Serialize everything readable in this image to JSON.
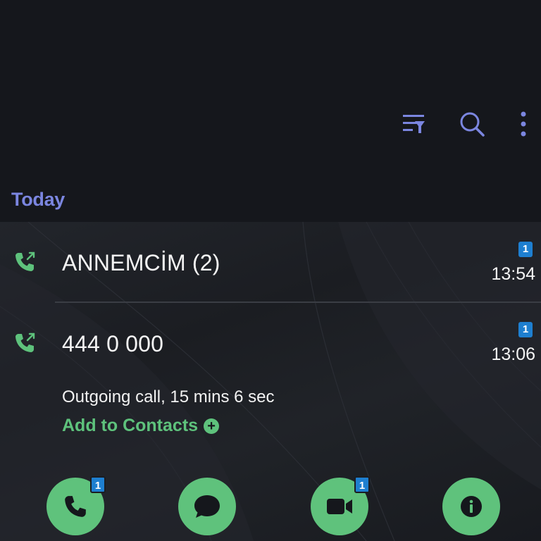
{
  "toolbar": {
    "filter_icon": "filter-list-icon",
    "search_icon": "search-icon",
    "more_icon": "more-vertical-icon",
    "accent": "#7b86e0"
  },
  "section": {
    "label": "Today"
  },
  "calls": [
    {
      "name": "ANNEMCİM (2)",
      "sim": "1",
      "time": "13:54",
      "type": "outgoing"
    },
    {
      "name": "444 0 000",
      "sim": "1",
      "time": "13:06",
      "type": "outgoing"
    }
  ],
  "expanded": {
    "details": "Outgoing call, 15 mins 6 sec",
    "add_to_contacts": "Add to Contacts"
  },
  "actions": {
    "call_badge": "1",
    "video_badge": "1",
    "accent": "#5fc27c",
    "badge_color": "#1e7fd0"
  }
}
